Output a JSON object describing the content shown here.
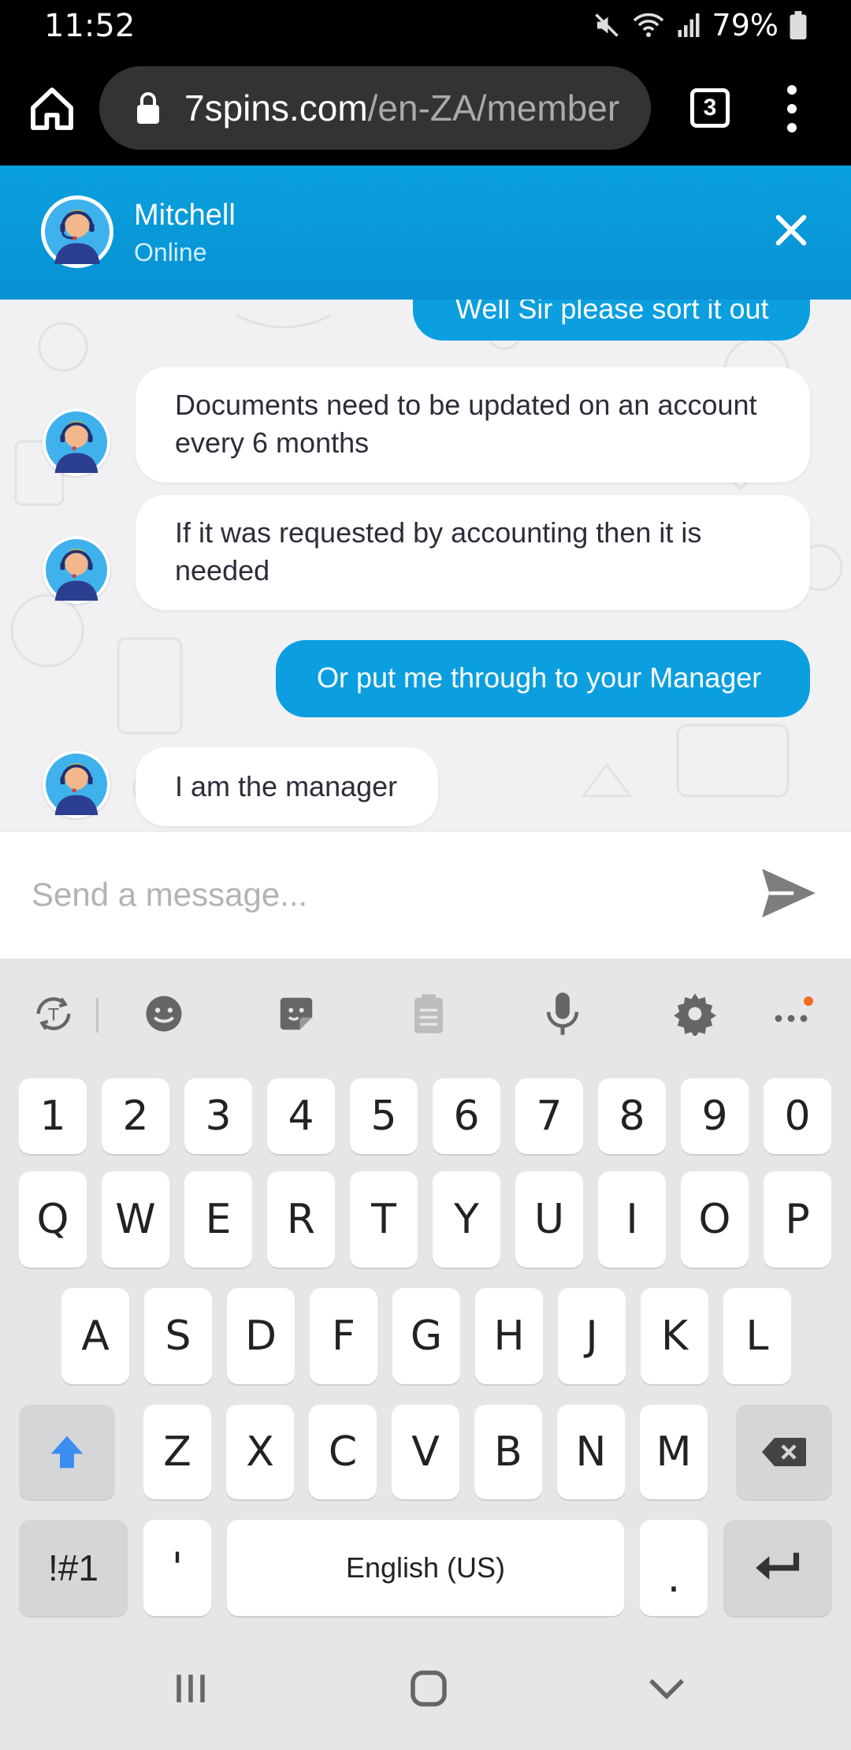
{
  "status_bar": {
    "time": "11:52",
    "battery": "79%"
  },
  "browser": {
    "url_domain": "7spins.com",
    "url_path": "/en-ZA/member",
    "tab_count": "3"
  },
  "chat_header": {
    "agent_name": "Mitchell",
    "agent_status": "Online"
  },
  "messages": [
    {
      "from": "user",
      "text": "Well Sir please sort it out"
    },
    {
      "from": "agent",
      "lines": [
        "Documents need to be updated on an account",
        "every 6 months"
      ]
    },
    {
      "from": "agent",
      "lines": [
        "If it was requested by accounting then it is",
        "needed"
      ]
    },
    {
      "from": "user",
      "text": "Or put me through to your Manager"
    },
    {
      "from": "agent",
      "text": "I am the manager"
    }
  ],
  "composer": {
    "placeholder": "Send a message..."
  },
  "keyboard": {
    "toolbar": [
      "text-mode-icon",
      "emoji-icon",
      "sticker-icon",
      "clipboard-icon",
      "microphone-icon",
      "gear-icon",
      "more-icon"
    ],
    "row_numbers": [
      "1",
      "2",
      "3",
      "4",
      "5",
      "6",
      "7",
      "8",
      "9",
      "0"
    ],
    "row_q": [
      "Q",
      "W",
      "E",
      "R",
      "T",
      "Y",
      "U",
      "I",
      "O",
      "P"
    ],
    "row_a": [
      "A",
      "S",
      "D",
      "F",
      "G",
      "H",
      "J",
      "K",
      "L"
    ],
    "row_z": [
      "Z",
      "X",
      "C",
      "V",
      "B",
      "N",
      "M"
    ],
    "symbols_label": "!#1",
    "apostrophe": "'",
    "space_label": "English (US)",
    "period": "."
  },
  "colors": {
    "header_blue": "#0aa0de",
    "bubble_out": "#0b9fe0",
    "shift_blue": "#3b8df0"
  }
}
